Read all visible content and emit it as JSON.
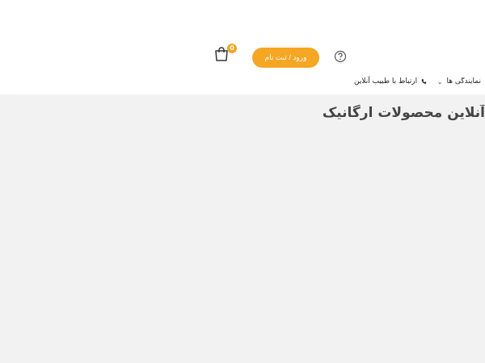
{
  "header": {
    "cart": {
      "icon": "shopping-bag-icon",
      "count": "0"
    },
    "login_label": "ورود / ثبت نام",
    "help_icon": "question-circle-icon"
  },
  "nav": {
    "agencies_label": "نمایندگی ها",
    "doctor_label": "ارتباط با طبیب آنلاین"
  },
  "main": {
    "title": "آنلاین محصولات ارگانیک"
  },
  "colors": {
    "accent": "#f5a623",
    "background": "#f2f2f2"
  }
}
